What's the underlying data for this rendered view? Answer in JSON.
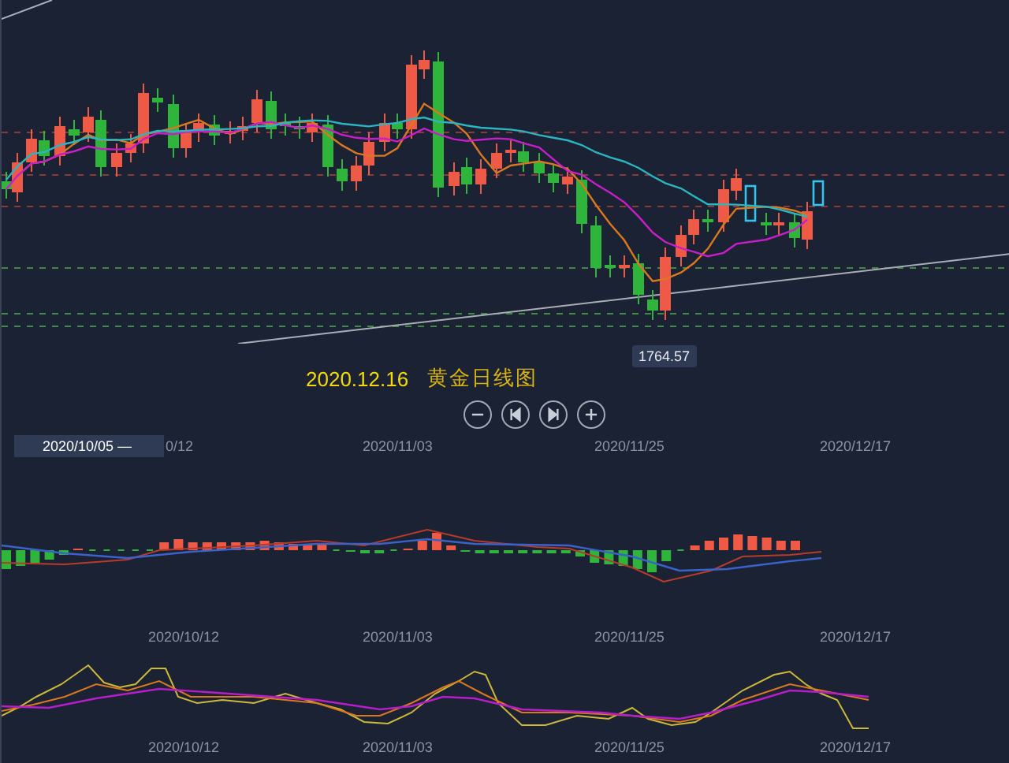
{
  "price_label": "1764.57",
  "title": {
    "date": "2020.12.16",
    "name": "黄金日线图"
  },
  "controls": [
    {
      "kind": "zoom-out"
    },
    {
      "kind": "previous"
    },
    {
      "kind": "next"
    },
    {
      "kind": "zoom-in"
    }
  ],
  "range_field": {
    "value": "2020/10/05 —"
  },
  "date_axes": [
    [
      "0/12",
      "2020/11/03",
      "2020/11/25",
      "2020/12/17"
    ],
    [
      "2020/10/12",
      "2020/11/03",
      "2020/11/25",
      "2020/12/17"
    ],
    [
      "2020/10/12",
      "2020/11/03",
      "2020/11/25",
      "2020/12/17"
    ]
  ]
}
